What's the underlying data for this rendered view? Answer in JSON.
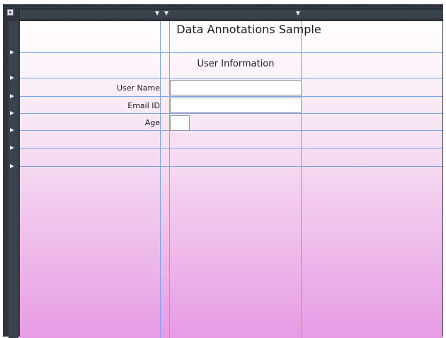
{
  "designer": {
    "title": "Data Annotations Sample",
    "section_header": "User Information",
    "fields": [
      {
        "label": "User Name",
        "value": ""
      },
      {
        "label": "Email ID",
        "value": ""
      },
      {
        "label": "Age",
        "value": ""
      }
    ]
  },
  "colors": {
    "frame": "#2b3138",
    "gridline": "#7ca6e8",
    "canvas_top": "#ffffff",
    "canvas_bottom": "#e79be4"
  }
}
